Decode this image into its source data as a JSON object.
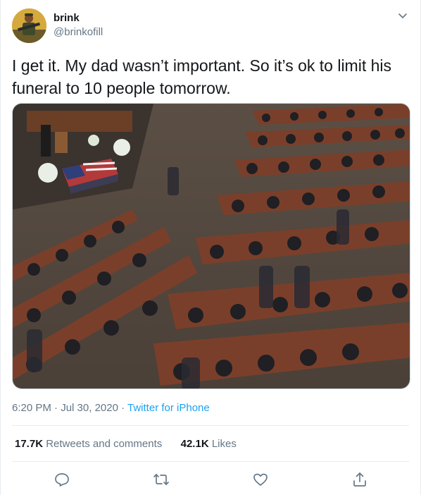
{
  "user": {
    "display_name": "brink",
    "handle": "@brinkofill",
    "avatar_icon": "avatar-image"
  },
  "tweet": {
    "text": "I get it.  My dad wasn’t important.  So it’s ok to limit his funeral to 10 people tomorrow.",
    "time": "6:20 PM",
    "separator1": " · ",
    "date": "Jul 30, 2020",
    "separator2": " · ",
    "source": "Twitter for iPhone"
  },
  "stats": {
    "retweets_count": "17.7K",
    "retweets_label": "Retweets and comments",
    "likes_count": "42.1K",
    "likes_label": "Likes"
  },
  "colors": {
    "link": "#1da1f2",
    "secondary_text": "#657786",
    "divider": "#e6ecf0"
  },
  "actions": [
    "reply-icon",
    "retweet-icon",
    "like-icon",
    "share-icon"
  ]
}
